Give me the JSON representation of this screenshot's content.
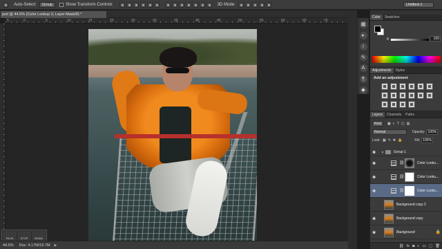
{
  "options_bar": {
    "auto_select_label": "Auto-Select:",
    "auto_select_value": "Group",
    "show_transform_label": "Show Transform Controls",
    "mode_3d_label": "3D Mode:",
    "workspace_value": "Untitled-1"
  },
  "document": {
    "tab_title": "psd @ 44.5% (Color Lookup 3, Layer Mask/8) *",
    "ruler_numbers": [
      "5",
      "0",
      "5",
      "10",
      "15",
      "20",
      "25",
      "30",
      "35",
      "40",
      "45",
      "50",
      "55",
      "60",
      "65",
      "70"
    ]
  },
  "pixel_icons": [
    "PAUS",
    "STOP",
    "DRAW"
  ],
  "status_bar": {
    "zoom": "44.5%",
    "doc_info": "Doc: 4.17M/16.7M"
  },
  "color_panel": {
    "tabs": [
      "Color",
      "Swatches"
    ],
    "k_label": "K",
    "k_value": "100"
  },
  "adjustments_panel": {
    "tabs": [
      "Adjustments",
      "Styles"
    ],
    "title": "Add an adjustment"
  },
  "layers_panel": {
    "tabs": [
      "Layers",
      "Channels",
      "Paths"
    ],
    "kind_label": "Kind",
    "blend_mode": "Normal",
    "opacity_label": "Opacity:",
    "opacity_value": "100%",
    "lock_label": "Lock:",
    "fill_label": "Fill:",
    "fill_value": "100%",
    "layers": [
      {
        "name": "Group 1",
        "type": "group",
        "visible": true,
        "selected": false
      },
      {
        "name": "Color Looku...",
        "type": "adjustment",
        "mask": "dark",
        "visible": true,
        "selected": false
      },
      {
        "name": "Color Looku...",
        "type": "adjustment",
        "mask": "white",
        "visible": true,
        "selected": false
      },
      {
        "name": "Color Looku...",
        "type": "adjustment",
        "mask": "white",
        "visible": true,
        "selected": true
      },
      {
        "name": "Background copy 2",
        "type": "pixel",
        "visible": false,
        "selected": false
      },
      {
        "name": "Background copy",
        "type": "pixel",
        "visible": true,
        "selected": false
      },
      {
        "name": "Background",
        "type": "pixel",
        "visible": true,
        "selected": false,
        "locked": true
      }
    ],
    "bottom_icons": [
      "link-icon",
      "fx-icon",
      "mask-icon",
      "adjustment-icon",
      "folder-icon",
      "new-layer-icon",
      "trash-icon"
    ]
  },
  "colors": {
    "selected_layer": "#596a86",
    "jacket_orange": "#f08a1e",
    "cart_handle_red": "#b8302c"
  }
}
